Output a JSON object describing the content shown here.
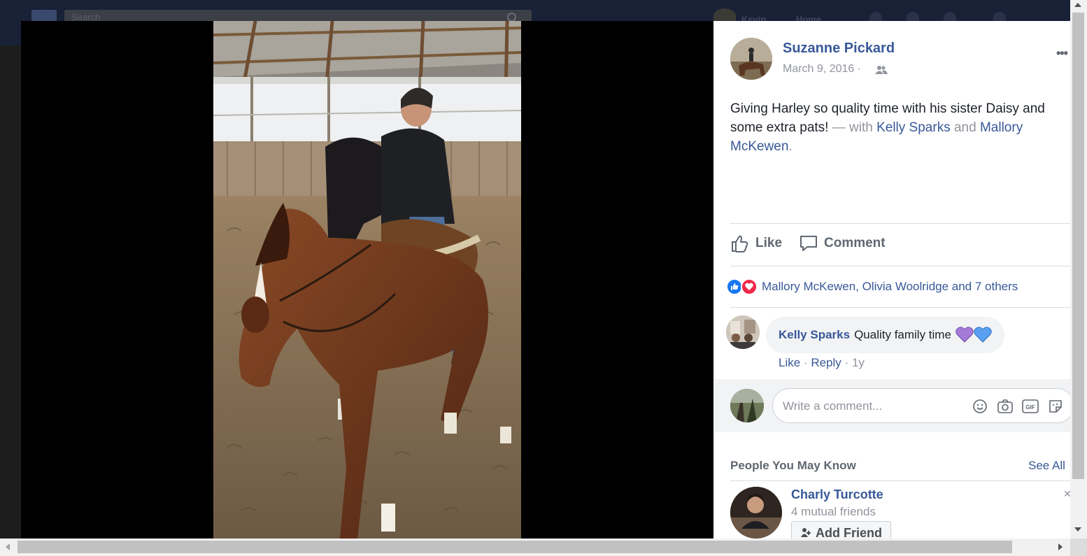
{
  "background": {
    "search_placeholder": "Search",
    "user_name": "Kevin",
    "home_label": "Home"
  },
  "post": {
    "author": "Suzanne Pickard",
    "date": "March 9, 2016",
    "date_separator": "·",
    "audience_icon": "friends-icon",
    "more_icon": "more-options-icon",
    "more_label": "•••",
    "text": "Giving Harley so quality time with his sister Daisy and some extra pats!",
    "with_label": "— with",
    "tagged": [
      "Kelly Sparks",
      "Mallory McKewen"
    ],
    "and_label": "and",
    "end_period": "."
  },
  "actions": {
    "like": "Like",
    "comment": "Comment"
  },
  "reactions": {
    "text": "Mallory McKewen, Olivia Woolridge and 7 others",
    "types": [
      "like",
      "love"
    ]
  },
  "comments": [
    {
      "author": "Kelly Sparks",
      "text": "Quality family time",
      "emoji": [
        "purple-heart",
        "blue-heart"
      ],
      "like": "Like",
      "reply": "Reply",
      "separator": "·",
      "age": "1y"
    }
  ],
  "composer": {
    "placeholder": "Write a comment...",
    "icons": [
      "emoji-icon",
      "camera-icon",
      "gif-icon",
      "sticker-icon"
    ],
    "gif_label": "GIF"
  },
  "pymk": {
    "title": "People You May Know",
    "see_all": "See All",
    "people": [
      {
        "name": "Charly Turcotte",
        "mutual": "4 mutual friends",
        "button": "Add Friend"
      }
    ]
  },
  "colors": {
    "link": "#385898",
    "muted": "#90949c",
    "like_blue": "#1877f2",
    "love_red": "#f0284a"
  }
}
